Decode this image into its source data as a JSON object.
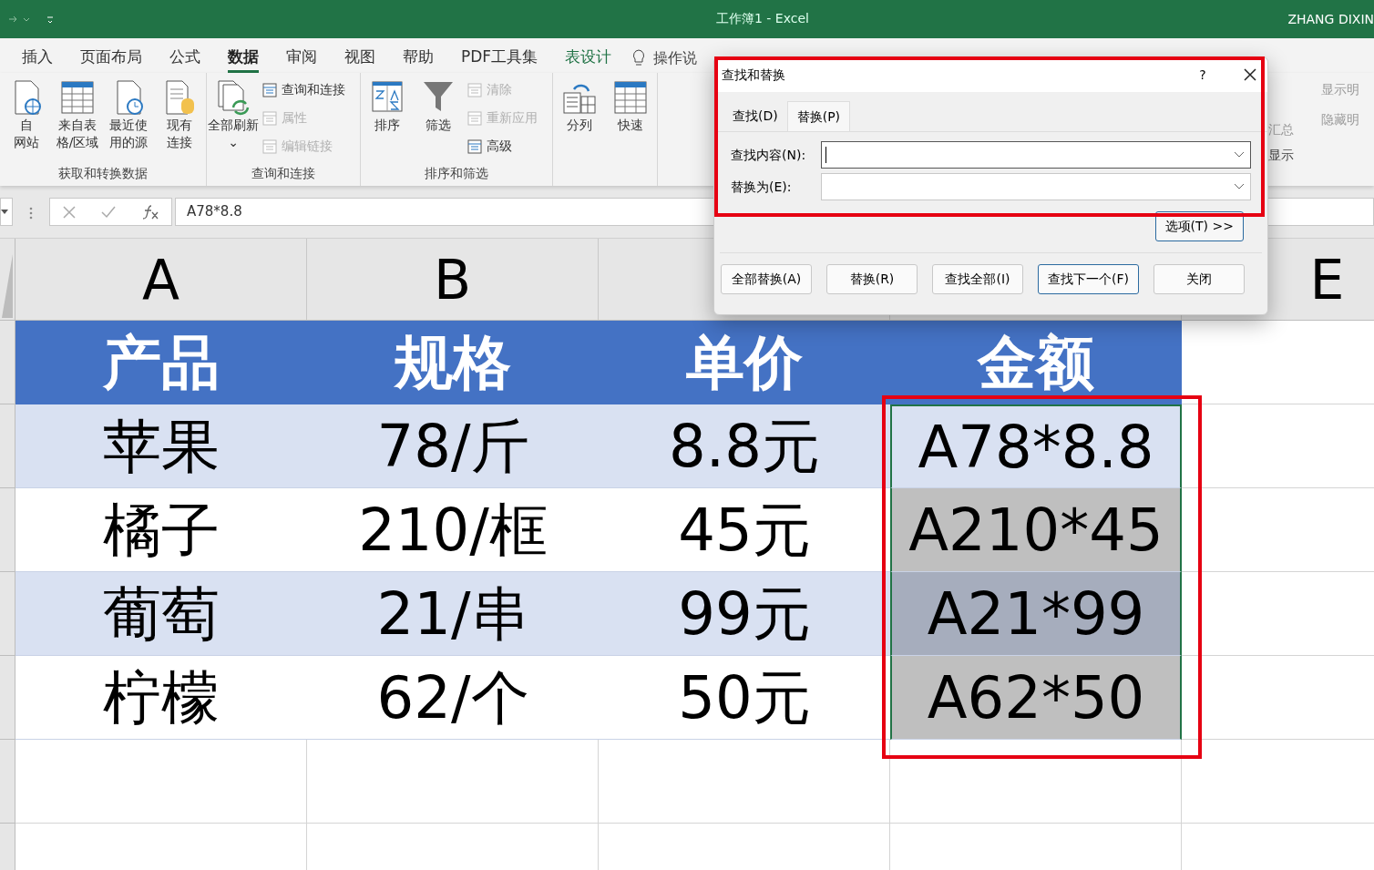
{
  "title_bar": {
    "title": "工作簿1  -  Excel",
    "user": "ZHANG DIXIN"
  },
  "ribbon": {
    "tabs": [
      {
        "label": "插入",
        "selected": false,
        "kind": "normal"
      },
      {
        "label": "页面布局",
        "selected": false,
        "kind": "normal"
      },
      {
        "label": "公式",
        "selected": false,
        "kind": "normal"
      },
      {
        "label": "数据",
        "selected": true,
        "kind": "normal"
      },
      {
        "label": "审阅",
        "selected": false,
        "kind": "normal"
      },
      {
        "label": "视图",
        "selected": false,
        "kind": "normal"
      },
      {
        "label": "帮助",
        "selected": false,
        "kind": "normal"
      },
      {
        "label": "PDF工具集",
        "selected": false,
        "kind": "normal"
      },
      {
        "label": "表设计",
        "selected": false,
        "kind": "contextual"
      }
    ],
    "tell_me": "操作说",
    "groups": [
      {
        "label": "获取和转换数据",
        "large": [
          {
            "lines": [
              "自",
              "网站"
            ],
            "kind": "web"
          },
          {
            "lines": [
              "来自表",
              "格/区域"
            ],
            "kind": "table"
          },
          {
            "lines": [
              "最近使",
              "用的源"
            ],
            "kind": "recent"
          },
          {
            "lines": [
              "现有",
              "连接"
            ],
            "kind": "db"
          }
        ]
      },
      {
        "label": "查询和连接",
        "large": [
          {
            "lines": [
              "全部刷新",
              "⌄"
            ],
            "kind": "refresh"
          }
        ],
        "small": [
          {
            "label": "查询和连接",
            "disabled": false
          },
          {
            "label": "属性",
            "disabled": true
          },
          {
            "label": "编辑链接",
            "disabled": true
          }
        ]
      },
      {
        "label": "排序和筛选",
        "large": [
          {
            "lines": [
              "排序"
            ],
            "kind": "sort"
          },
          {
            "lines": [
              "筛选"
            ],
            "kind": "filter"
          }
        ],
        "small": [
          {
            "label": "清除",
            "disabled": true
          },
          {
            "label": "重新应用",
            "disabled": true
          },
          {
            "label": "高级",
            "disabled": false
          }
        ]
      },
      {
        "large": [
          {
            "lines": [
              "分列"
            ],
            "kind": "split"
          },
          {
            "lines": [
              "快速"
            ],
            "kind": "table"
          }
        ]
      }
    ],
    "right_items": [
      "显示明",
      "隐藏明"
    ],
    "right_big": "汇总",
    "right_group": "显示"
  },
  "formula_bar": {
    "formula": "A78*8.8"
  },
  "sheet": {
    "column_headers": {
      "column_1": "A",
      "column_2": "B",
      "column_5": "E"
    },
    "amount_column_framed": true,
    "header": [
      "产品",
      "规格",
      "单价",
      "金额"
    ],
    "rows": [
      [
        {
          "text": "苹果",
          "selected": false
        },
        {
          "text": "78/斤",
          "selected": false
        },
        {
          "text": "8.8元",
          "selected": false
        },
        {
          "text": "A78*8.8",
          "selected": true
        }
      ],
      [
        {
          "text": "橘子",
          "selected": false
        },
        {
          "text": "210/框",
          "selected": false
        },
        {
          "text": "45元",
          "selected": false
        },
        {
          "text": "A210*45",
          "selected": true
        }
      ],
      [
        {
          "text": "葡萄",
          "selected": false
        },
        {
          "text": "21/串",
          "selected": false
        },
        {
          "text": "99元",
          "selected": false
        },
        {
          "text": "A21*99",
          "selected": true
        }
      ],
      [
        {
          "text": "柠檬",
          "selected": false
        },
        {
          "text": "62/个",
          "selected": false
        },
        {
          "text": "50元",
          "selected": false
        },
        {
          "text": "A62*50",
          "selected": true
        }
      ]
    ]
  },
  "dialog": {
    "title": "查找和替换",
    "help": "?",
    "highlighted": true,
    "tabs": [
      {
        "label": "查找(D)",
        "selected": false
      },
      {
        "label": "替换(P)",
        "selected": true
      }
    ],
    "fields": [
      {
        "label": "查找内容(N):",
        "focused": true
      },
      {
        "label": "替换为(E):",
        "focused": false
      }
    ],
    "options_button": "选项(T) >>",
    "buttons": [
      {
        "label": "全部替换(A)",
        "default": false
      },
      {
        "label": "替换(R)",
        "default": false
      },
      {
        "label": "查找全部(I)",
        "default": false
      },
      {
        "label": "查找下一个(F)",
        "default": true
      },
      {
        "label": "关闭",
        "default": false
      }
    ]
  }
}
